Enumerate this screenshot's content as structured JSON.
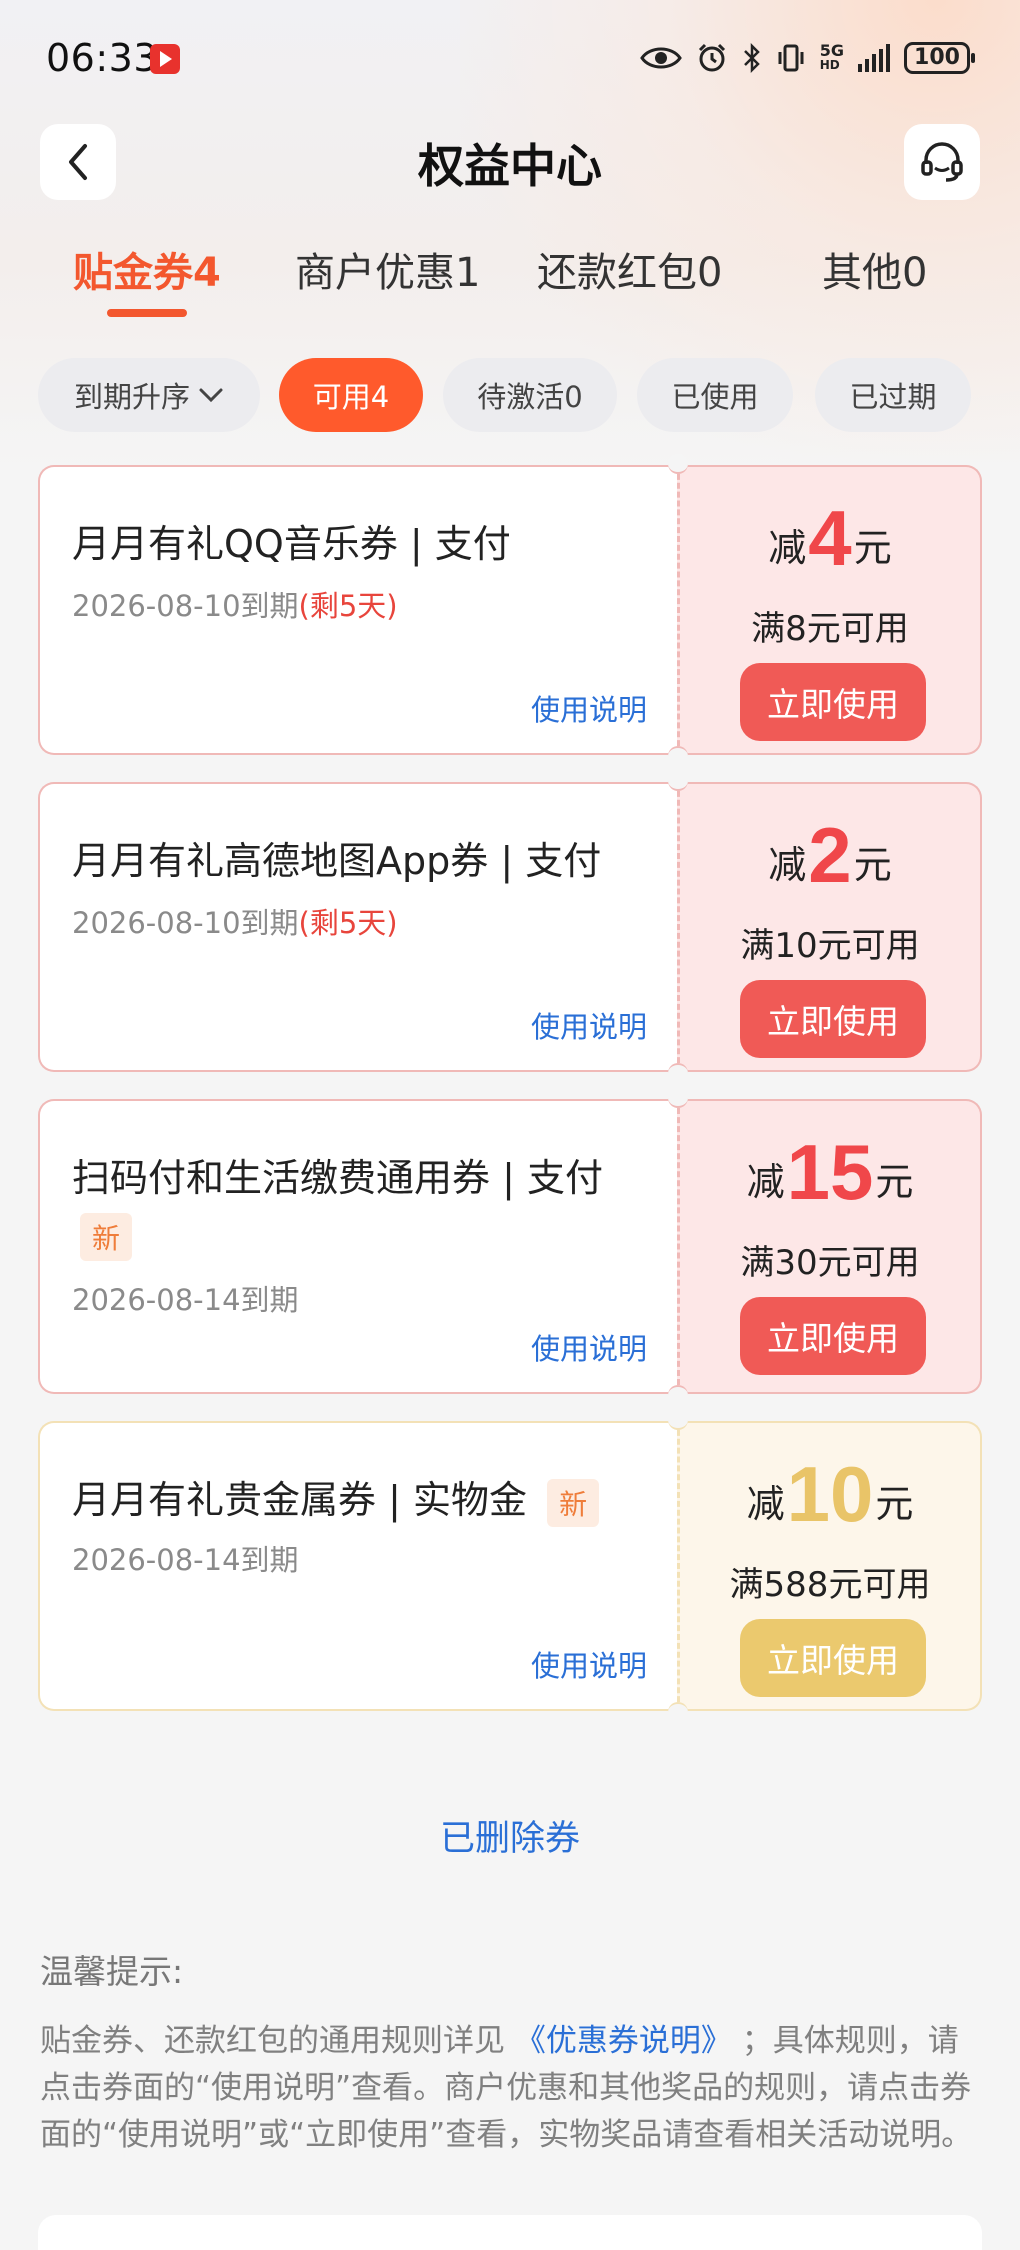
{
  "status_bar": {
    "time": "06:33",
    "net_top": "5G",
    "net_bottom": "HD",
    "battery": "100"
  },
  "header": {
    "title": "权益中心"
  },
  "tabs": [
    {
      "label": "贴金券4",
      "active": true
    },
    {
      "label": "商户优惠1",
      "active": false
    },
    {
      "label": "还款红包0",
      "active": false
    },
    {
      "label": "其他0",
      "active": false
    }
  ],
  "filters": {
    "sort_label": "到期升序",
    "items": [
      {
        "label": "可用4",
        "active": true
      },
      {
        "label": "待激活0",
        "active": false
      },
      {
        "label": "已使用",
        "active": false
      },
      {
        "label": "已过期",
        "active": false
      }
    ]
  },
  "coupons": [
    {
      "title": "月月有礼QQ音乐券 | 支付",
      "date": "2026-08-10到期",
      "remaining": "(剩5天)",
      "desc_link": "使用说明",
      "amount_prefix": "减",
      "amount": "4",
      "amount_unit": "元",
      "condition": "满8元可用",
      "button": "立即使用"
    },
    {
      "title": "月月有礼高德地图App券 | 支付",
      "date": "2026-08-10到期",
      "remaining": "(剩5天)",
      "desc_link": "使用说明",
      "amount_prefix": "减",
      "amount": "2",
      "amount_unit": "元",
      "condition": "满10元可用",
      "button": "立即使用"
    },
    {
      "title": "扫码付和生活缴费通用券 | 支付",
      "badge": "新",
      "date": "2026-08-14到期",
      "desc_link": "使用说明",
      "amount_prefix": "减",
      "amount": "15",
      "amount_unit": "元",
      "condition": "满30元可用",
      "button": "立即使用"
    },
    {
      "title": "月月有礼贵金属券 | 实物金",
      "badge": "新",
      "date": "2026-08-14到期",
      "desc_link": "使用说明",
      "amount_prefix": "减",
      "amount": "10",
      "amount_unit": "元",
      "condition": "满588元可用",
      "button": "立即使用"
    }
  ],
  "deleted_link": "已删除券",
  "tips": {
    "title": "温馨提示:",
    "text_before": "贴金券、还款红包的通用规则详见",
    "link": "《优惠券说明》",
    "text_after": "；具体规则，请点击券面的“使用说明”查看。商户优惠和其他奖品的规则，请点击券面的“使用说明”或“立即使用”查看，实物奖品请查看相关活动说明。"
  },
  "colors": {
    "accent": "#f3572e",
    "coupon_red": "#f0474a",
    "coupon_gold": "#e9c468",
    "link_blue": "#2a6fd6"
  }
}
